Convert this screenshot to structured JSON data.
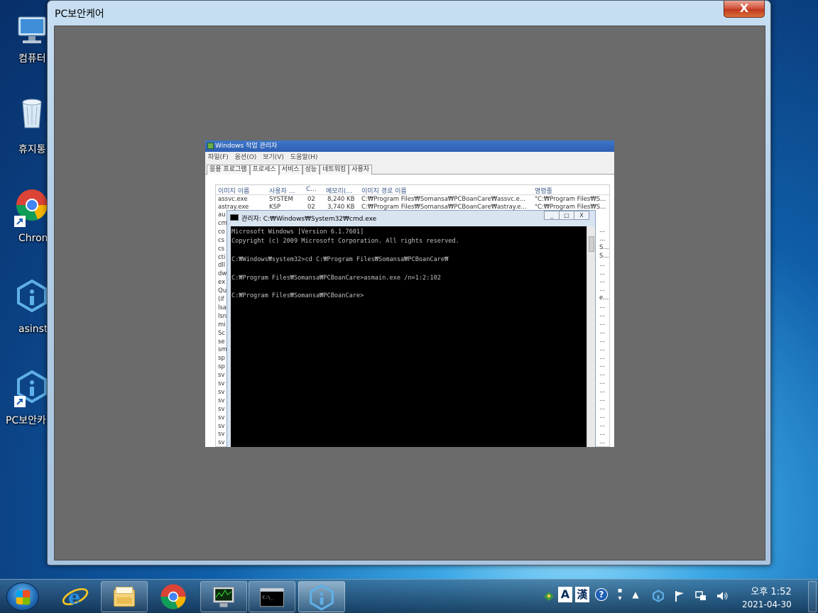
{
  "desktop": {
    "icons": [
      {
        "label": "컴퓨터",
        "icon": "computer-icon"
      },
      {
        "label": "휴지통",
        "icon": "recycle-bin-icon"
      },
      {
        "label": "Chrom",
        "icon": "chrome-icon"
      },
      {
        "label": "asinst",
        "icon": "asinst-icon"
      },
      {
        "label": "PC보안카",
        "icon": "pc-security-icon"
      }
    ]
  },
  "window": {
    "title": "PC보안케어",
    "close_label": "X"
  },
  "task_manager": {
    "title": "Windows 작업 관리자",
    "menu": [
      "파일(F)",
      "옵션(O)",
      "보기(V)",
      "도움말(H)"
    ],
    "tabs": [
      "응용 프로그램",
      "프로세스",
      "서비스",
      "성능",
      "네트워킹",
      "사용자"
    ],
    "active_tab": "프로세스",
    "columns": [
      "이미지 이름",
      "사용자 ...",
      "C...",
      "메모리(...",
      "이미지 경로 이름",
      "명령줄"
    ],
    "rows": [
      [
        "assvc.exe",
        "SYSTEM",
        "02",
        "8,240 KB",
        "C:₩Program Files₩Somansa₩PCBoanCare₩assvc.e...",
        "\"C:₩Program Files₩S..."
      ],
      [
        "astray.exe",
        "KSP",
        "02",
        "3,740 KB",
        "C:₩Program Files₩Somansa₩PCBoanCare₩astray.e...",
        "\"C:₩Program Files₩S..."
      ]
    ],
    "left_fragments": [
      "au",
      "cm",
      "co",
      "cs",
      "cs",
      "cti",
      "dll",
      "dw",
      "ex",
      "Qu",
      "(if",
      "lsa",
      "lsn",
      "mi",
      "Sc",
      "se",
      "sm",
      "sp",
      "sp",
      "sv",
      "sv",
      "sv",
      "sv",
      "sv",
      "sv",
      "sv",
      "sv",
      "sv"
    ],
    "right_fragments": [
      "...",
      "...",
      "S...",
      "S...",
      "...",
      "...",
      "...",
      "...",
      "e...",
      "...",
      "...",
      "...",
      "...",
      "...",
      "...",
      "...",
      "...",
      "...",
      "...",
      "...",
      "...",
      "...",
      "...",
      "...",
      "...",
      "...",
      "..."
    ]
  },
  "cmd": {
    "title": "관리자: C:₩Windows₩System32₩cmd.exe",
    "controls": [
      "_",
      "□",
      "X"
    ],
    "lines": [
      "Microsoft Windows [Version 6.1.7601]",
      "Copyright (c) 2009 Microsoft Corporation. All rights reserved.",
      "",
      "C:₩Windows₩system32>cd C:₩Program Files₩Somansa₩PCBoanCare₩",
      "",
      "C:₩Program Files₩Somansa₩PCBoanCare>asmain.exe /n=1:2:102",
      "",
      "C:₩Program Files₩Somansa₩PCBoanCare>"
    ]
  },
  "taskbar": {
    "buttons": [
      "internet-explorer-icon",
      "file-explorer-icon",
      "chrome-icon",
      "task-manager-icon",
      "cmd-icon",
      "pc-security-icon"
    ],
    "tray": {
      "ime_a": "A",
      "ime_han": "漢",
      "help": "?",
      "time": "오후 1:52",
      "date": "2021-04-30"
    }
  }
}
